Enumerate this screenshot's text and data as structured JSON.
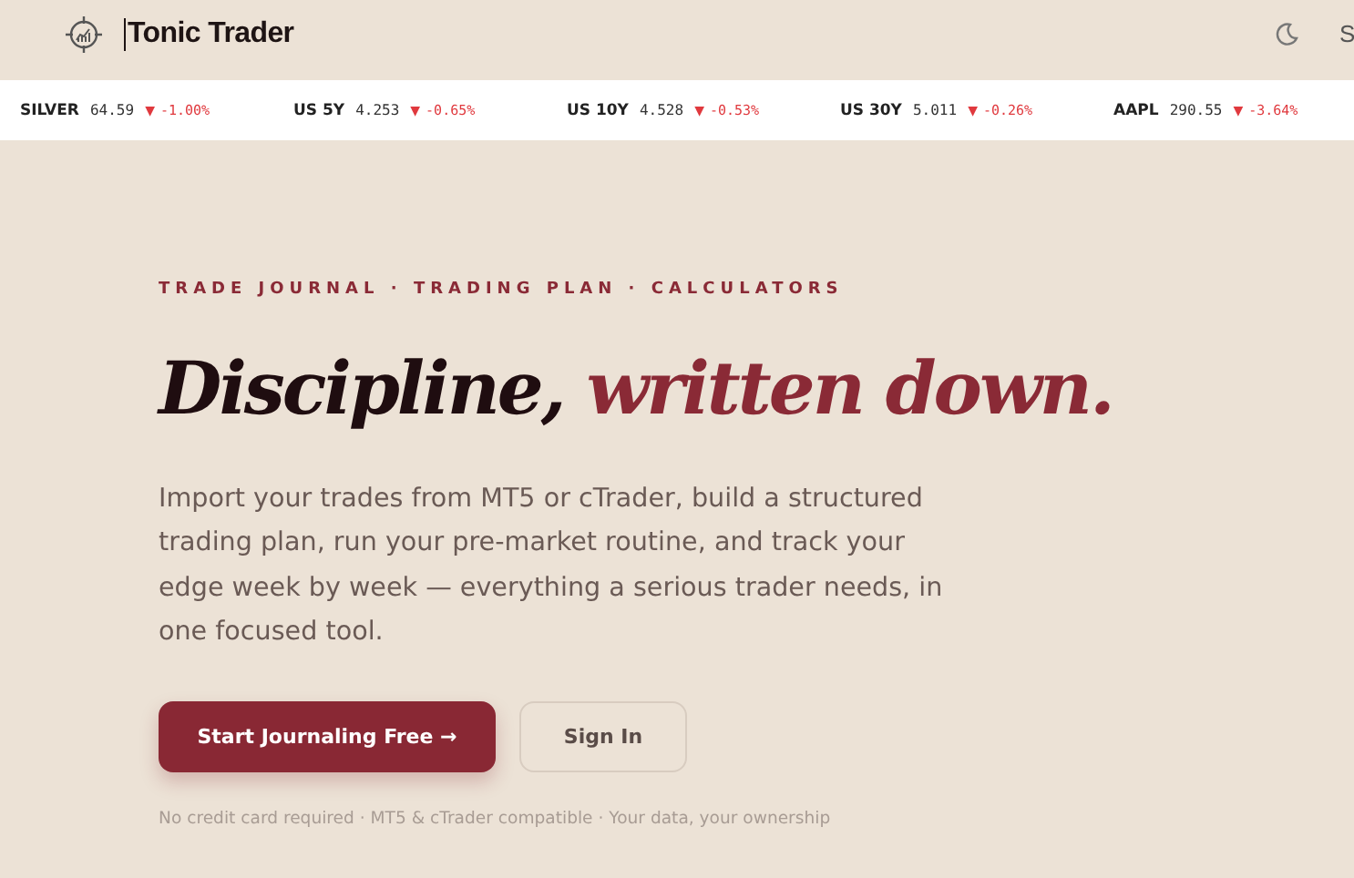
{
  "header": {
    "brand": "Tonic Trader",
    "nav_cut": "S"
  },
  "ticker": [
    {
      "symbol": "SILVER",
      "price": "64.59",
      "change": "-1.00%",
      "arrow": "▼"
    },
    {
      "symbol": "US 5Y",
      "price": "4.253",
      "change": "-0.65%",
      "arrow": "▼"
    },
    {
      "symbol": "US 10Y",
      "price": "4.528",
      "change": "-0.53%",
      "arrow": "▼"
    },
    {
      "symbol": "US 30Y",
      "price": "5.011",
      "change": "-0.26%",
      "arrow": "▼"
    },
    {
      "symbol": "AAPL",
      "price": "290.55",
      "change": "-3.64%",
      "arrow": "▼"
    }
  ],
  "hero": {
    "eyebrow": "TRADE JOURNAL · TRADING PLAN · CALCULATORS",
    "headline": "Discipline,",
    "headline_accent": "written down.",
    "description": "Import your trades from MT5 or cTrader, build a structured trading plan, run your pre-market routine, and track your edge week by week — everything a serious trader needs, in one focused tool.",
    "buttons": [
      {
        "label": "Start Journaling Free →",
        "kind": "primary"
      },
      {
        "label": "Sign In",
        "kind": "secondary"
      }
    ],
    "footnote": "No credit card required · MT5 & cTrader compatible · Your data, your ownership"
  }
}
